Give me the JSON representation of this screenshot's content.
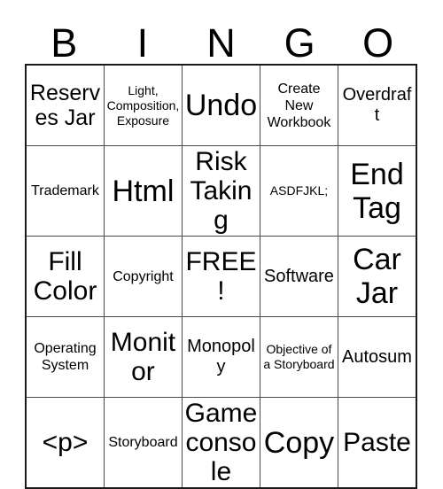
{
  "card": {
    "header_letters": [
      "B",
      "I",
      "N",
      "G",
      "O"
    ],
    "columns": 5,
    "rows": 5,
    "free_space_label": "FREE!",
    "border_color": "#4a4a4a",
    "outer_border_color": "#1a1a1a",
    "background_color": "#ffffff",
    "text_color": "#000000"
  },
  "cells": [
    [
      {
        "text": "Reserves Jar",
        "size": "lg"
      },
      {
        "text": "Light, Composition, Exposure",
        "size": "xs"
      },
      {
        "text": "Undo",
        "size": "xxl"
      },
      {
        "text": "Create New Workbook",
        "size": "sm"
      },
      {
        "text": "Overdraft",
        "size": "md"
      }
    ],
    [
      {
        "text": "Trademark",
        "size": "sm"
      },
      {
        "text": "Html",
        "size": "xxl"
      },
      {
        "text": "Risk Taking",
        "size": "xl"
      },
      {
        "text": "ASDFJKL;",
        "size": "xs"
      },
      {
        "text": "End Tag",
        "size": "xxl"
      }
    ],
    [
      {
        "text": "Fill Color",
        "size": "xl"
      },
      {
        "text": "Copyright",
        "size": "sm"
      },
      {
        "text": "FREE!",
        "size": "xl"
      },
      {
        "text": "Software",
        "size": "md"
      },
      {
        "text": "Car Jar",
        "size": "xxl"
      }
    ],
    [
      {
        "text": "Operating System",
        "size": "sm"
      },
      {
        "text": "Monitor",
        "size": "xl"
      },
      {
        "text": "Monopoly",
        "size": "md"
      },
      {
        "text": "Objective of a Storyboard",
        "size": "xs"
      },
      {
        "text": "Autosum",
        "size": "md"
      }
    ],
    [
      {
        "text": "<p>",
        "size": "xl"
      },
      {
        "text": "Storyboard",
        "size": "sm"
      },
      {
        "text": "Game console",
        "size": "xl"
      },
      {
        "text": "Copy",
        "size": "xxl"
      },
      {
        "text": "Paste",
        "size": "xl"
      }
    ]
  ]
}
